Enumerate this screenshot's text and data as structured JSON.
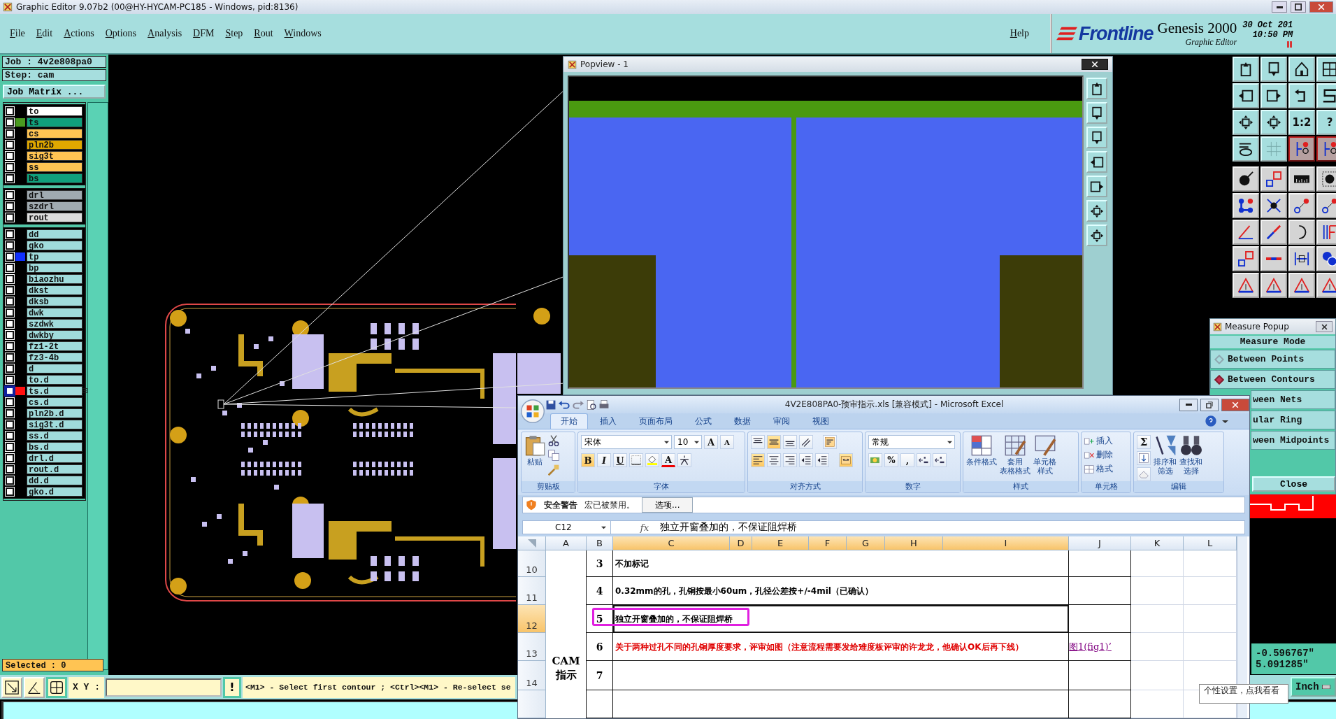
{
  "title_bar": {
    "title": "Graphic Editor 9.07b2 (00@HY-HYCAM-PC185 - Windows, pid:8136)"
  },
  "menu": [
    "File",
    "Edit",
    "Actions",
    "Options",
    "Analysis",
    "DFM",
    "Step",
    "Rout",
    "Windows"
  ],
  "help": "Help",
  "brand": {
    "logo": "Frontline",
    "product": "Genesis 2000",
    "subtitle": "Graphic Editor",
    "date": "30 Oct 201",
    "time": "10:50 PM"
  },
  "job": {
    "job": "Job : 4v2e808pa0",
    "step": "Step: cam",
    "matrix_button": "Job Matrix ..."
  },
  "layer_groups": [
    {
      "layers": [
        {
          "name": "to",
          "color": "#ffffff",
          "affected": false
        },
        {
          "name": "ts",
          "color": "#10a07c",
          "swatch": {
            "color": "#4a9a20"
          },
          "affected": false
        },
        {
          "name": "cs",
          "color": "#ffc453",
          "affected": false
        },
        {
          "name": "pln2b",
          "color": "#e0a800",
          "affected": false
        },
        {
          "name": "sig3t",
          "color": "#ffc453",
          "affected": false
        },
        {
          "name": "ss",
          "color": "#ffc453",
          "affected": false
        },
        {
          "name": "bs",
          "color": "#10a07c",
          "affected": false
        }
      ]
    },
    {
      "layers": [
        {
          "name": "drl",
          "color": "#a0aab0",
          "affected": false
        },
        {
          "name": "szdrl",
          "color": "#a0aab0",
          "affected": false
        },
        {
          "name": "rout",
          "color": "#dcdcdc",
          "affected": false
        }
      ]
    },
    {
      "layers": [
        {
          "name": "dd",
          "color": "#a0dcdc",
          "affected": false
        },
        {
          "name": "gko",
          "color": "#a0dcdc",
          "affected": false
        },
        {
          "name": "tp",
          "color": "#a0dcdc",
          "swatch": {
            "color": "#1030ff"
          },
          "affected": false
        },
        {
          "name": "bp",
          "color": "#a0dcdc",
          "affected": false
        },
        {
          "name": "biaozhu",
          "color": "#a0dcdc",
          "affected": false
        },
        {
          "name": "dkst",
          "color": "#a0dcdc",
          "affected": false
        },
        {
          "name": "dksb",
          "color": "#a0dcdc",
          "affected": false
        },
        {
          "name": "dwk",
          "color": "#a0dcdc",
          "affected": false
        },
        {
          "name": "szdwk",
          "color": "#a0dcdc",
          "affected": false
        },
        {
          "name": "dwkby",
          "color": "#a0dcdc",
          "affected": false
        },
        {
          "name": "fz1-2t",
          "color": "#a0dcdc",
          "affected": false
        },
        {
          "name": "fz3-4b",
          "color": "#a0dcdc",
          "affected": false
        },
        {
          "name": "d",
          "color": "#a0dcdc",
          "affected": false
        },
        {
          "name": "to.d",
          "color": "#a0dcdc",
          "affected": false
        },
        {
          "name": "ts.d",
          "color": "#a0dcdc",
          "swatch": {
            "color": "#ff1010"
          },
          "affected": true
        },
        {
          "name": "cs.d",
          "color": "#a0dcdc",
          "affected": false
        },
        {
          "name": "pln2b.d",
          "color": "#a0dcdc",
          "affected": false
        },
        {
          "name": "sig3t.d",
          "color": "#a0dcdc",
          "affected": false
        },
        {
          "name": "ss.d",
          "color": "#a0dcdc",
          "affected": false
        },
        {
          "name": "bs.d",
          "color": "#a0dcdc",
          "affected": false
        },
        {
          "name": "drl.d",
          "color": "#a0dcdc",
          "affected": false
        },
        {
          "name": "rout.d",
          "color": "#a0dcdc",
          "affected": false
        },
        {
          "name": "dd.d",
          "color": "#a0dcdc",
          "affected": false
        },
        {
          "name": "gko.d",
          "color": "#a0dcdc",
          "affected": false
        }
      ]
    }
  ],
  "selected_count": "Selected : 0",
  "tools": {
    "labels": [
      "1:2",
      "?"
    ]
  },
  "popview": {
    "title": "Popview - 1"
  },
  "measure": {
    "title": "Measure Popup",
    "header": "Measure Mode",
    "close": "Close",
    "modes": [
      {
        "label": "Between Points",
        "selected": false
      },
      {
        "label": "Between Contours",
        "selected": true
      },
      {
        "label": "ween Nets",
        "selected": false
      },
      {
        "label": "ular Ring",
        "selected": false
      },
      {
        "label": "ween Midpoints",
        "selected": false
      }
    ]
  },
  "readout": {
    "x": "-0.596767\"",
    "y": "5.091285\""
  },
  "unit_button": "Inch",
  "status": {
    "modes": [
      {
        "selected": false
      },
      {
        "selected": false
      },
      {
        "selected": true
      }
    ],
    "xy_label": "X Y :",
    "alert": "!",
    "message": "<M1> - Select first contour ; <Ctrl><M1> - Re-select se"
  },
  "excel": {
    "title": "4V2E808PA0-预审指示.xls  [兼容模式] - Microsoft Excel",
    "tabs": [
      {
        "label": "开始",
        "selected": true
      },
      {
        "label": "插入",
        "selected": false
      },
      {
        "label": "页面布局",
        "selected": false
      },
      {
        "label": "公式",
        "selected": false
      },
      {
        "label": "数据",
        "selected": false
      },
      {
        "label": "审阅",
        "selected": false
      },
      {
        "label": "视图",
        "selected": false
      }
    ],
    "ribbon": {
      "paste": "粘贴",
      "font": "宋体",
      "size": "10",
      "grow": "A",
      "shrink": "A",
      "bold": "B",
      "italic": "I",
      "underline": "U",
      "font_color": "A",
      "number_format": "常规",
      "percent": "%",
      "comma": ",",
      "cond_format": [
        "条件格式"
      ],
      "table_format": [
        "套用",
        "表格格式"
      ],
      "cell_style": [
        "单元格",
        "样式"
      ],
      "insert": "插入",
      "delete": "删除",
      "format": "格式",
      "sum": "Σ",
      "sort": [
        "排序和",
        "筛选"
      ],
      "find": [
        "查找和",
        "选择"
      ],
      "groups": [
        "剪贴板",
        "字体",
        "对齐方式",
        "数字",
        "样式",
        "单元格",
        "编辑"
      ]
    },
    "security": {
      "title": "安全警告",
      "message": "宏已被禁用。",
      "button": "选项..."
    },
    "name_box": "C12",
    "fx": "fx",
    "formula": "独立开窗叠加的，不保证阻焊桥",
    "columns": [
      {
        "label": "A",
        "selected": false
      },
      {
        "label": "B",
        "selected": false
      },
      {
        "label": "C",
        "selected": true
      },
      {
        "label": "D",
        "selected": true
      },
      {
        "label": "E",
        "selected": true
      },
      {
        "label": "F",
        "selected": true
      },
      {
        "label": "G",
        "selected": true
      },
      {
        "label": "H",
        "selected": true
      },
      {
        "label": "I",
        "selected": true
      },
      {
        "label": "J",
        "selected": false
      },
      {
        "label": "K",
        "selected": false
      },
      {
        "label": "L",
        "selected": false
      }
    ],
    "section": "CAM\n指示",
    "rows": [
      {
        "number": "10",
        "selected": false,
        "item": "3",
        "text": "不加标记",
        "emphasis": false,
        "annotated": false
      },
      {
        "number": "11",
        "selected": false,
        "item": "4",
        "text": "0.32mm的孔，孔铜按最小60um，孔径公差按+/-4mil（已确认）",
        "emphasis": false,
        "annotated": false
      },
      {
        "number": "12",
        "selected": true,
        "item": "5",
        "text": "独立开窗叠加的，不保证阻焊桥",
        "emphasis": false,
        "annotated": true
      },
      {
        "number": "13",
        "selected": false,
        "item": "6",
        "text": "关于两种过孔不同的孔铜厚度要求，评审如图（注意流程需要发给难度板评审的许龙龙，他确认OK后再下线）",
        "emphasis": true,
        "annotated": false,
        "link": "图1(fig1)’"
      },
      {
        "number": "14",
        "selected": false,
        "item": "7",
        "emphasis": false,
        "annotated": false
      }
    ]
  },
  "tooltip": "个性设置，点我看看"
}
